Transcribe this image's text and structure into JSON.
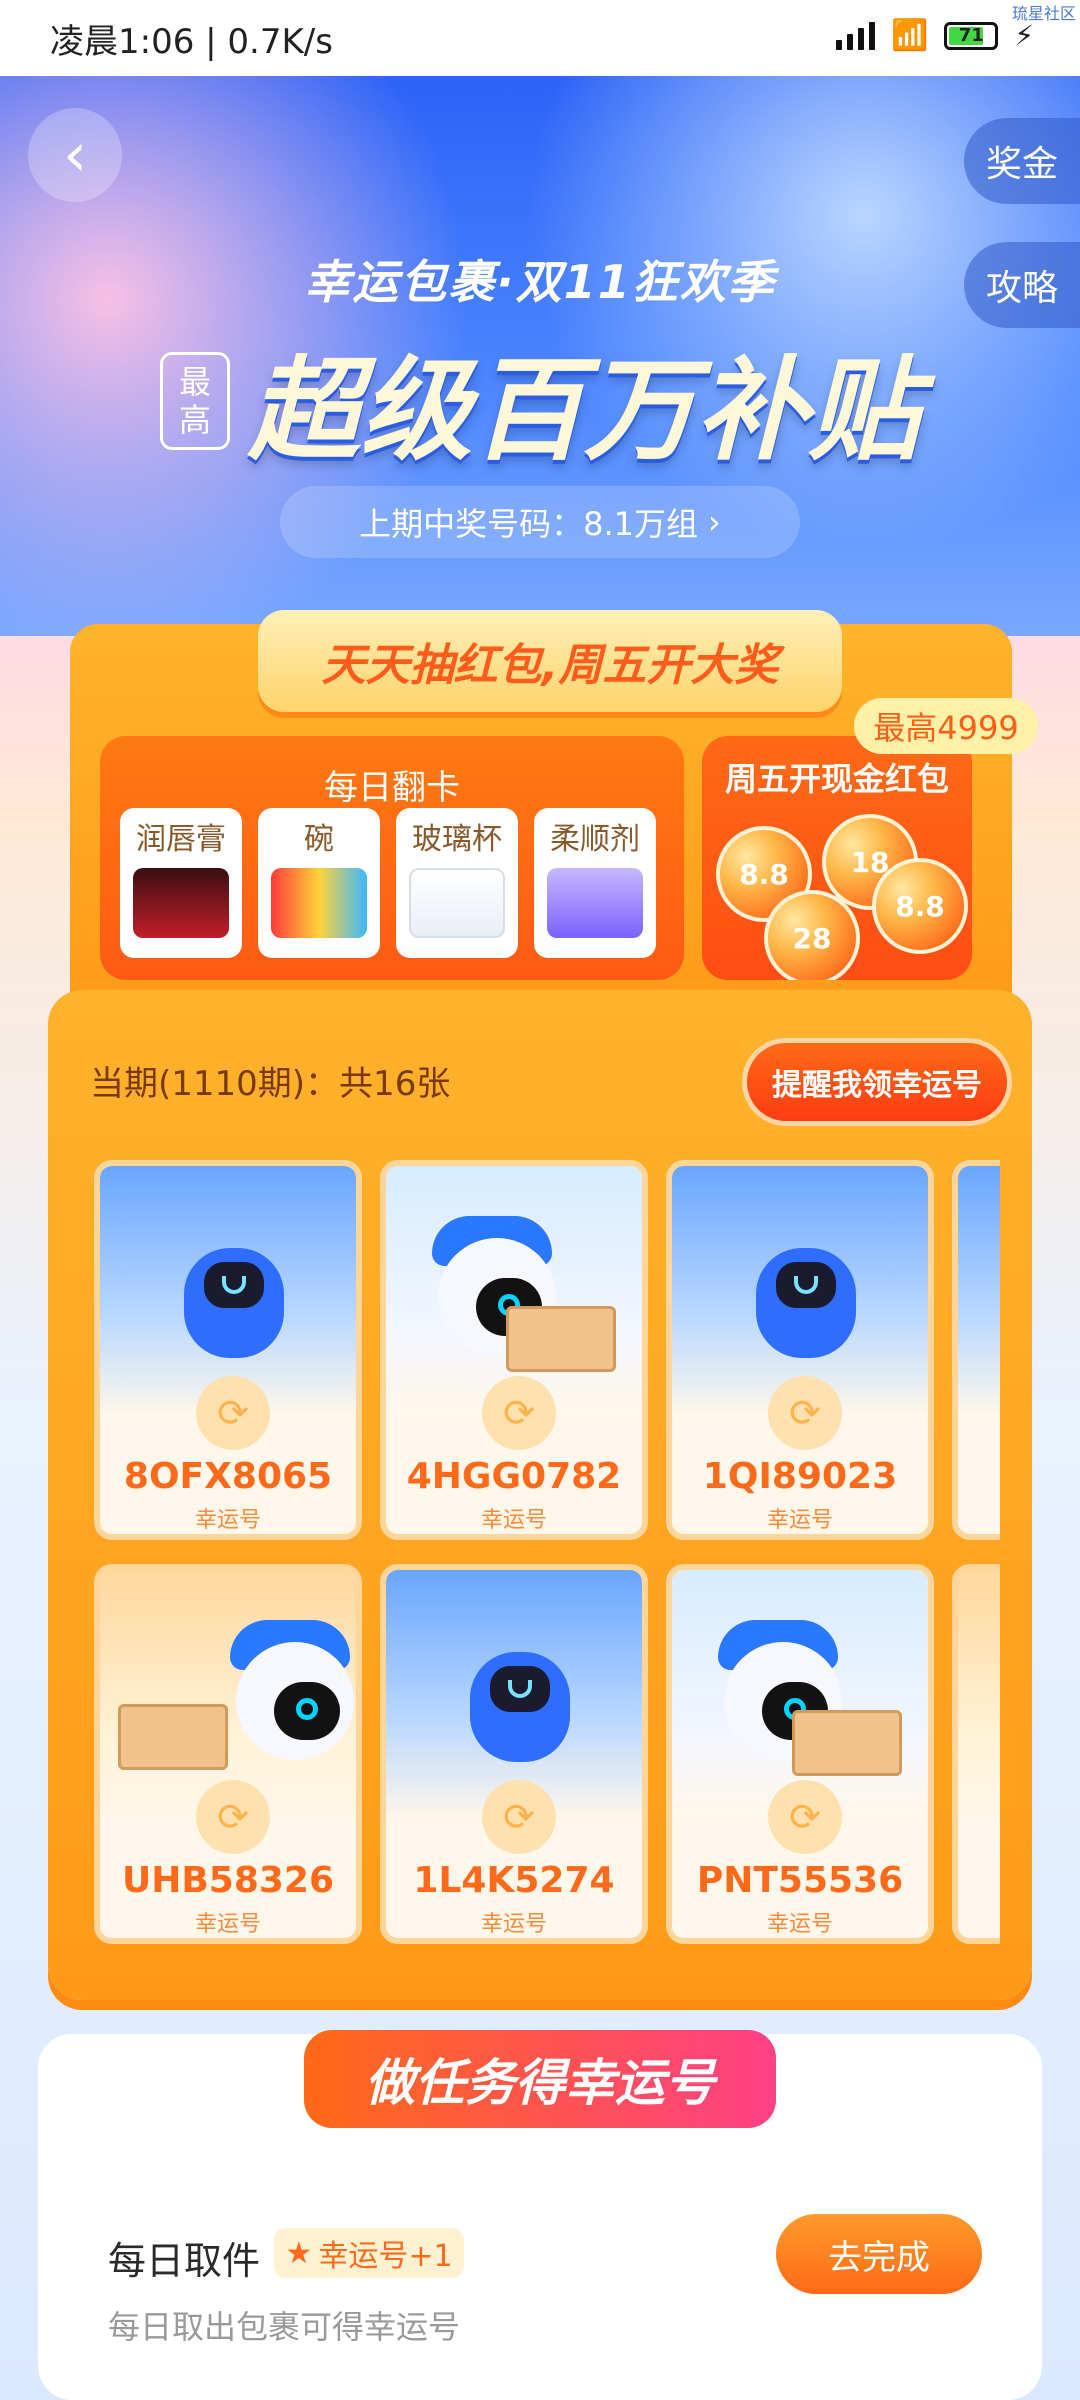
{
  "status_bar": {
    "time_and_speed": "凌晨1:06 | 0.7K/s",
    "battery_level": "71",
    "corner_text": "琉星社区"
  },
  "header": {
    "back_icon": "chevron-left",
    "side_tabs": [
      "奖金",
      "攻略"
    ]
  },
  "hero": {
    "subtitle": "幸运包裹·双11狂欢季",
    "badge_lines": [
      "最",
      "高"
    ],
    "title": "超级百万补贴",
    "last_period_pill": "上期中奖号码：8.1万组"
  },
  "banner": {
    "title": "天天抽红包,周五开大奖"
  },
  "daily_flip": {
    "title": "每日翻卡",
    "prizes": [
      "润唇膏",
      "碗",
      "玻璃杯",
      "柔顺剂"
    ]
  },
  "friday": {
    "title": "周五开现金红包",
    "max_badge": "最高4999",
    "balls": [
      "8.8",
      "18",
      "28",
      "8.8"
    ]
  },
  "period": {
    "summary": "当期(1110期)：共16张",
    "remind_button": "提醒我领幸运号"
  },
  "tickets": [
    {
      "code": "8OFX8065",
      "label": "幸运号",
      "art": "robot-blue"
    },
    {
      "code": "4HGG0782",
      "label": "幸运号",
      "art": "robot-white-box"
    },
    {
      "code": "1QI89023",
      "label": "幸运号",
      "art": "robot-blue"
    },
    {
      "code": "UHB58326",
      "label": "幸运号",
      "art": "robot-white-phone"
    },
    {
      "code": "1L4K5274",
      "label": "幸运号",
      "art": "robot-blue"
    },
    {
      "code": "PNT55536",
      "label": "幸运号",
      "art": "robot-white-box"
    }
  ],
  "tasks": {
    "section_title": "做任务得幸运号",
    "items": [
      {
        "title": "每日取件",
        "tag": "幸运号+1",
        "description": "每日取出包裹可得幸运号",
        "button": "去完成"
      }
    ]
  },
  "colors": {
    "orange": "#ff6a16",
    "yellow": "#ffb22c",
    "blue": "#2c63f7",
    "pink": "#ff3f86"
  }
}
